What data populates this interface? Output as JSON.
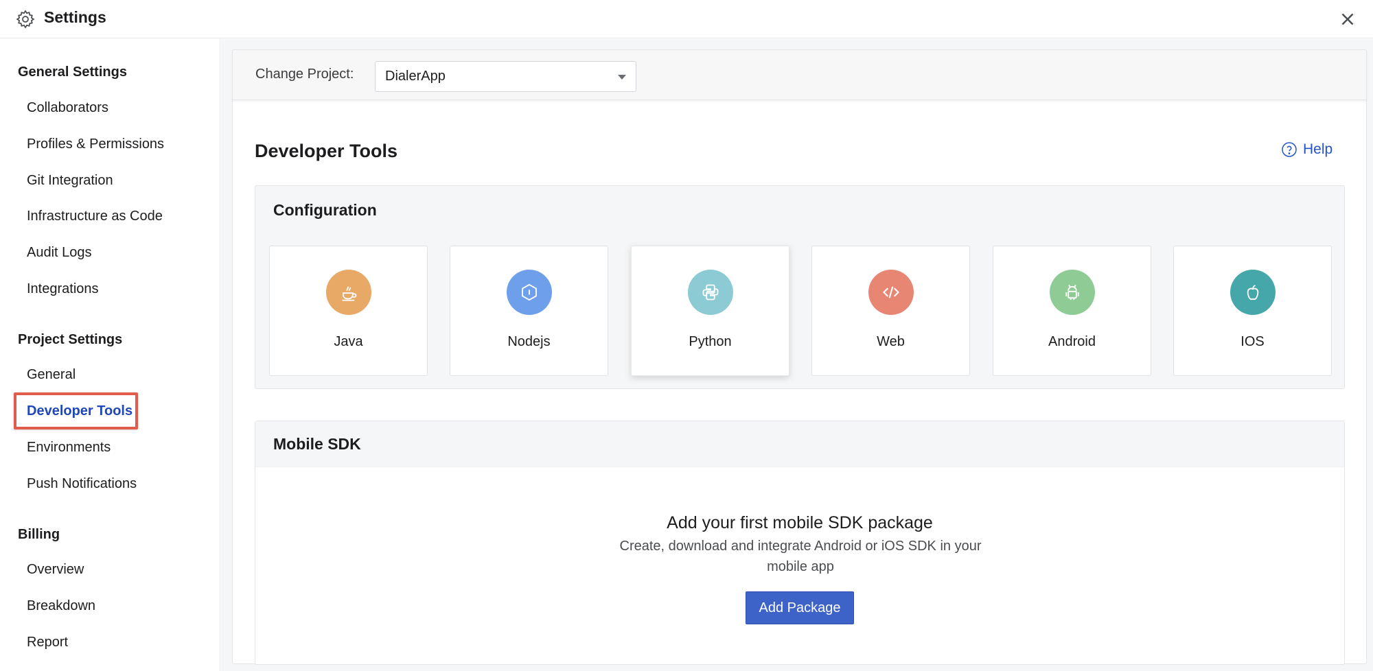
{
  "header": {
    "title": "Settings",
    "settings_icon": "gear-icon",
    "close_icon": "close-icon"
  },
  "sidebar": {
    "sections": [
      {
        "heading": "General Settings",
        "items": [
          "Collaborators",
          "Profiles & Permissions",
          "Git Integration",
          "Infrastructure as Code",
          "Audit Logs",
          "Integrations"
        ]
      },
      {
        "heading": "Project Settings",
        "items": [
          "General",
          "Developer Tools",
          "Environments",
          "Push Notifications"
        ]
      },
      {
        "heading": "Billing",
        "items": [
          "Overview",
          "Breakdown",
          "Report"
        ]
      }
    ],
    "active_item": "Developer Tools",
    "highlight_color": "#e25c4c"
  },
  "project": {
    "label": "Change Project:",
    "selected": "DialerApp"
  },
  "page": {
    "title": "Developer Tools",
    "help_label": "Help"
  },
  "configuration": {
    "title": "Configuration",
    "tiles": [
      {
        "name": "Java",
        "icon": "java-icon",
        "color": "#e8a866"
      },
      {
        "name": "Nodejs",
        "icon": "nodejs-icon",
        "color": "#6e9fea"
      },
      {
        "name": "Python",
        "icon": "python-icon",
        "color": "#8ccbd3"
      },
      {
        "name": "Web",
        "icon": "code-icon",
        "color": "#e78673"
      },
      {
        "name": "Android",
        "icon": "android-icon",
        "color": "#8fcb94"
      },
      {
        "name": "IOS",
        "icon": "apple-icon",
        "color": "#45a7a9"
      }
    ],
    "selected_tile": "Python"
  },
  "mobile_sdk": {
    "title": "Mobile SDK",
    "empty_title": "Add your first mobile SDK package",
    "empty_description": "Create, download and integrate Android or iOS SDK in your mobile app",
    "button_label": "Add Package",
    "button_color": "#3e63c8"
  }
}
